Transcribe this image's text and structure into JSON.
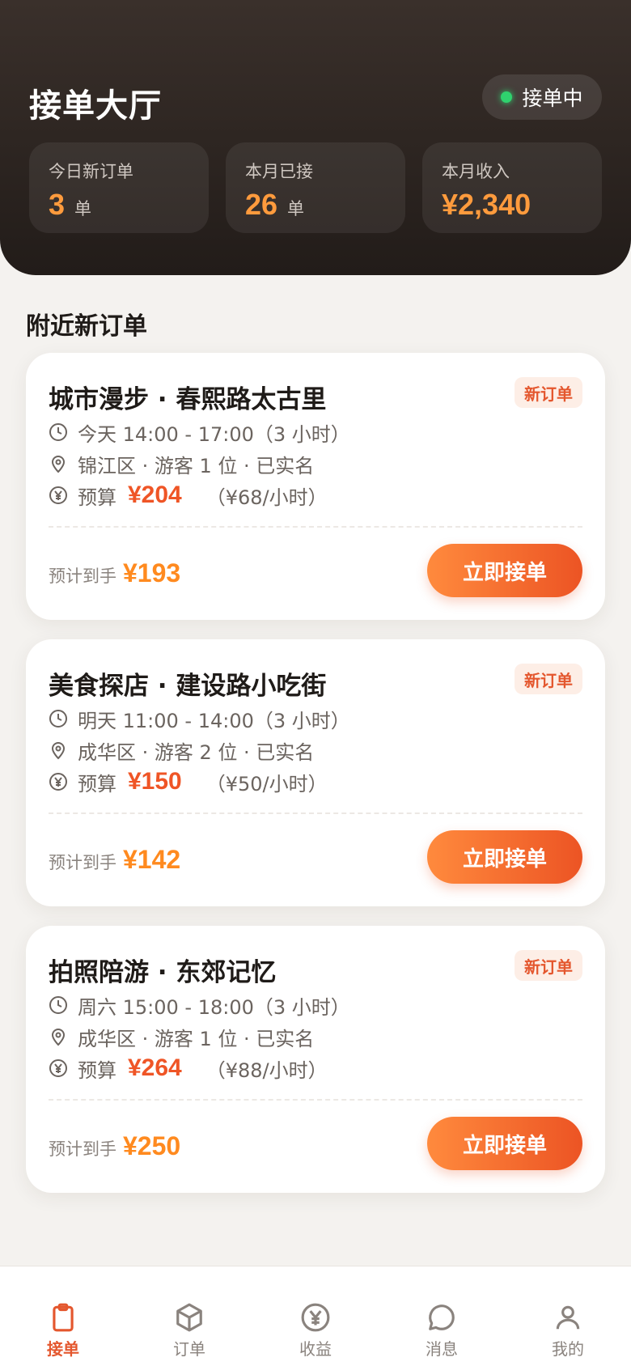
{
  "header": {
    "title": "接单大厅",
    "status": "接单中",
    "stats": [
      {
        "label": "今日新订单",
        "value": "3",
        "unit": "单"
      },
      {
        "label": "本月已接",
        "value": "26",
        "unit": "单"
      },
      {
        "label": "本月收入",
        "value": "¥2,340",
        "unit": ""
      }
    ]
  },
  "section_title": "附近新订单",
  "orders": [
    {
      "title": "城市漫步 · 春熙路太古里",
      "badge": "新订单",
      "time": "今天 14:00 - 17:00（3 小时）",
      "location": "锦江区 · 游客 1 位 · 已实名",
      "budget_label": "预算",
      "budget": "¥204",
      "rate": "（¥68/小时）",
      "earn_label": "预计到手",
      "earn": "¥193",
      "action": "立即接单"
    },
    {
      "title": "美食探店 · 建设路小吃街",
      "badge": "新订单",
      "time": "明天 11:00 - 14:00（3 小时）",
      "location": "成华区 · 游客 2 位 · 已实名",
      "budget_label": "预算",
      "budget": "¥150",
      "rate": "（¥50/小时）",
      "earn_label": "预计到手",
      "earn": "¥142",
      "action": "立即接单"
    },
    {
      "title": "拍照陪游 · 东郊记忆",
      "badge": "新订单",
      "time": "周六 15:00 - 18:00（3 小时）",
      "location": "成华区 · 游客 1 位 · 已实名",
      "budget_label": "预算",
      "budget": "¥264",
      "rate": "（¥88/小时）",
      "earn_label": "预计到手",
      "earn": "¥250",
      "action": "立即接单"
    }
  ],
  "tabs": [
    {
      "label": "接单",
      "icon": "clipboard-icon",
      "active": true
    },
    {
      "label": "订单",
      "icon": "box-icon",
      "active": false
    },
    {
      "label": "收益",
      "icon": "yen-circle-icon",
      "active": false
    },
    {
      "label": "消息",
      "icon": "chat-bubble-icon",
      "active": false
    },
    {
      "label": "我的",
      "icon": "user-icon",
      "active": false
    }
  ],
  "colors": {
    "accent": "#e4572e",
    "price": "#ef5526",
    "earn": "#ff8a1f",
    "header_bg": "#2a221e",
    "status_dot": "#2fd26e"
  }
}
